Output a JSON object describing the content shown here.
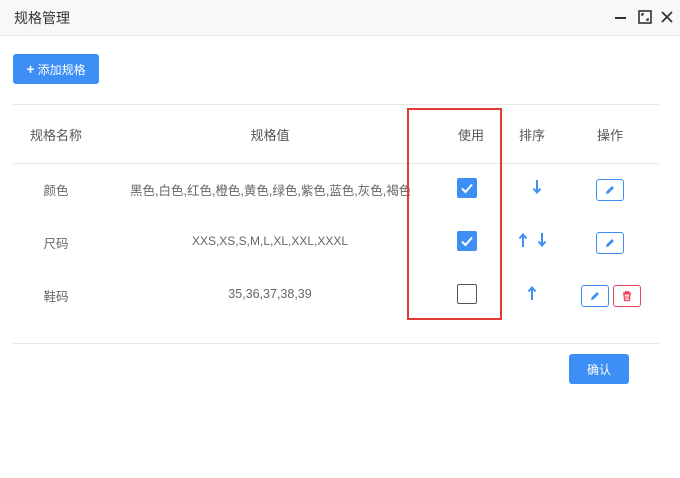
{
  "window": {
    "title": "规格管理"
  },
  "toolbar": {
    "add_label": "添加规格",
    "add_icon": "plus-icon"
  },
  "table": {
    "headers": [
      "规格名称",
      "规格值",
      "使用",
      "排序",
      "操作"
    ],
    "rows": [
      {
        "name": "颜色",
        "values": "黑色,白色,红色,橙色,黄色,绿色,紫色,蓝色,灰色,褐色",
        "used": true,
        "sort": [
          "down"
        ],
        "ops": [
          "edit"
        ]
      },
      {
        "name": "尺码",
        "values": "XXS,XS,S,M,L,XL,XXL,XXXL",
        "used": true,
        "sort": [
          "up",
          "down"
        ],
        "ops": [
          "edit"
        ]
      },
      {
        "name": "鞋码",
        "values": "35,36,37,38,39",
        "used": false,
        "sort": [
          "up"
        ],
        "ops": [
          "edit",
          "delete"
        ]
      }
    ]
  },
  "footer": {
    "confirm_label": "确认"
  },
  "colors": {
    "primary": "#3d8ff5",
    "danger": "#e8475b",
    "highlight": "#e53935"
  }
}
